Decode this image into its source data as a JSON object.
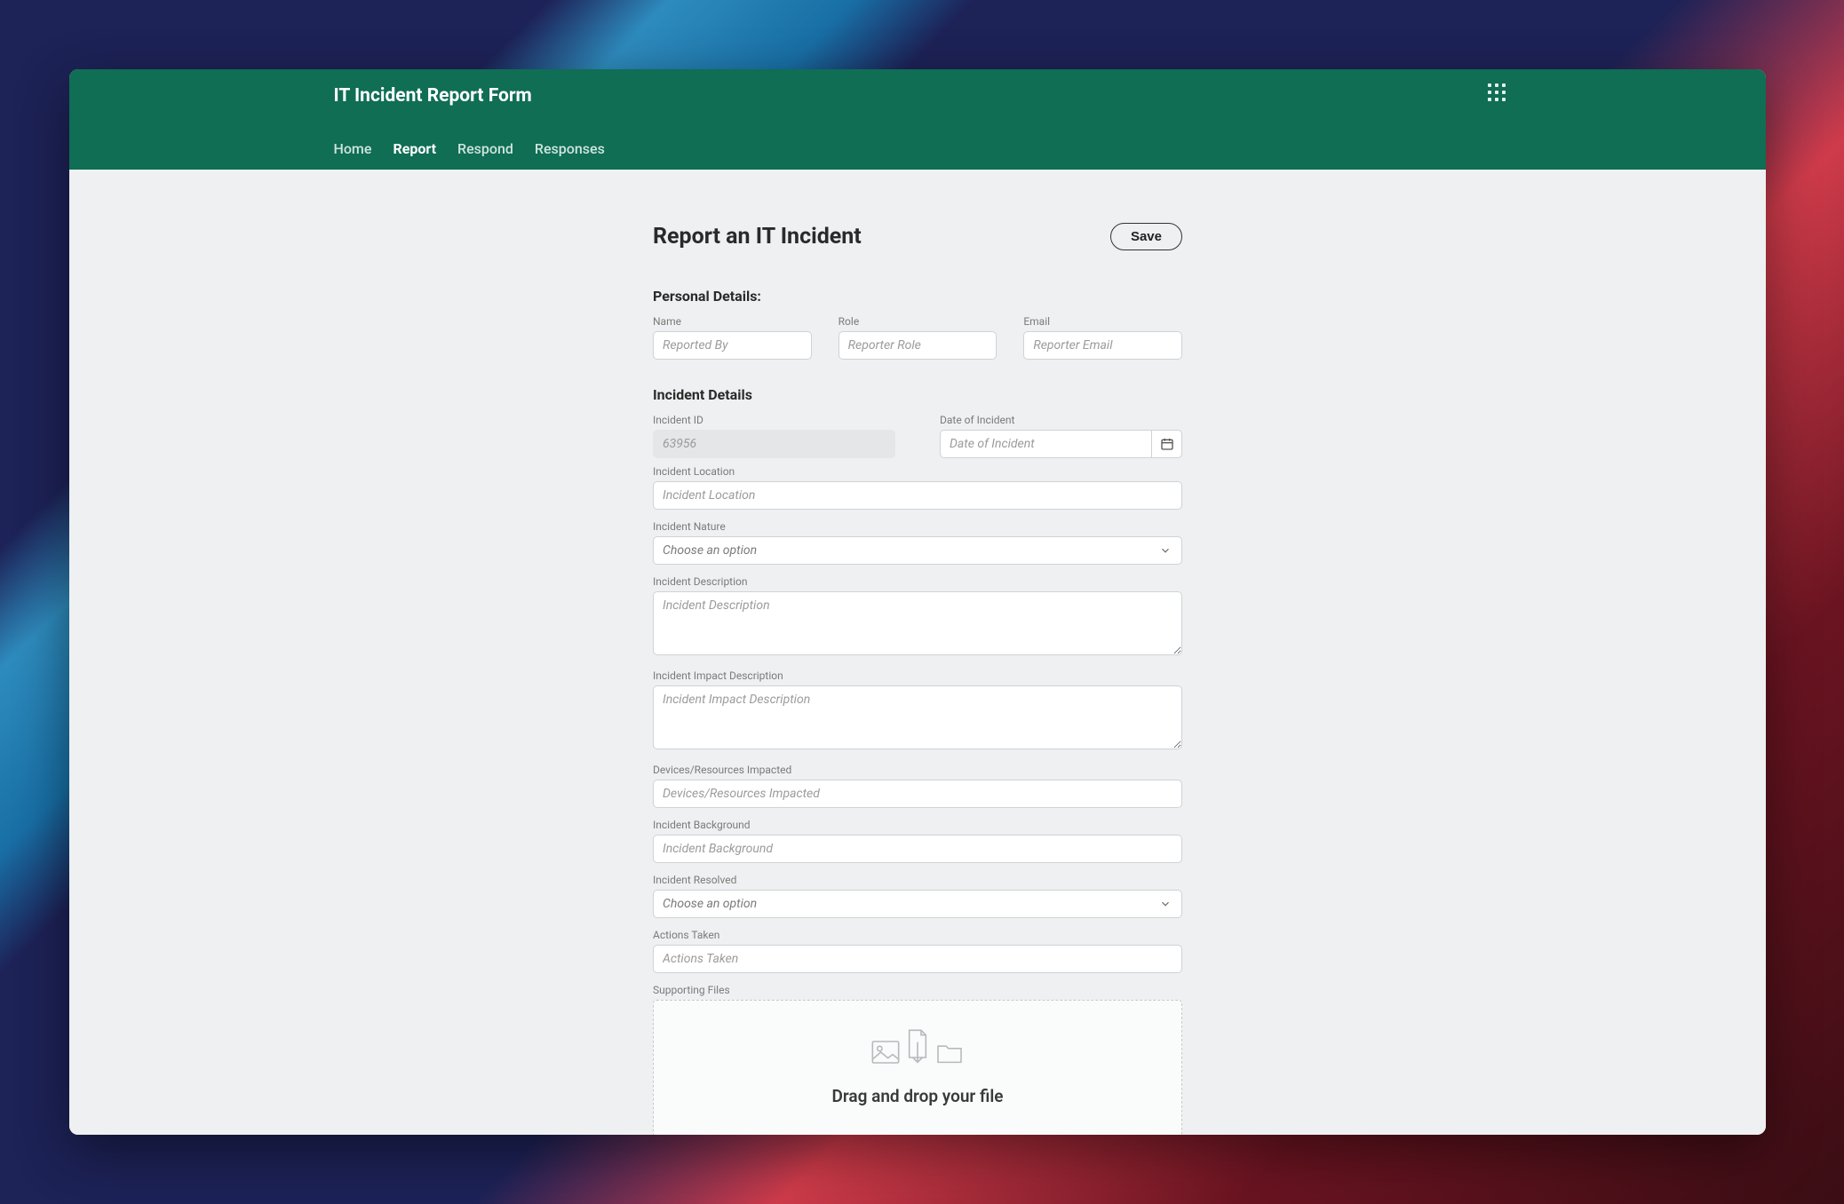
{
  "header": {
    "title": "IT Incident Report Form",
    "nav": {
      "home": "Home",
      "report": "Report",
      "respond": "Respond",
      "responses": "Responses"
    }
  },
  "page": {
    "title": "Report an IT Incident",
    "save_label": "Save"
  },
  "sections": {
    "personal": "Personal Details:",
    "incident": "Incident Details"
  },
  "fields": {
    "name": {
      "label": "Name",
      "placeholder": "Reported By"
    },
    "role": {
      "label": "Role",
      "placeholder": "Reporter Role"
    },
    "email": {
      "label": "Email",
      "placeholder": "Reporter Email"
    },
    "incident_id": {
      "label": "Incident ID",
      "value": "63956"
    },
    "date_of_incident": {
      "label": "Date of Incident",
      "placeholder": "Date of Incident"
    },
    "location": {
      "label": "Incident Location",
      "placeholder": "Incident Location"
    },
    "nature": {
      "label": "Incident Nature",
      "placeholder": "Choose an option"
    },
    "description": {
      "label": "Incident Description",
      "placeholder": "Incident Description"
    },
    "impact": {
      "label": "Incident Impact Description",
      "placeholder": "Incident Impact Description"
    },
    "devices": {
      "label": "Devices/Resources Impacted",
      "placeholder": "Devices/Resources Impacted"
    },
    "background": {
      "label": "Incident Background",
      "placeholder": "Incident Background"
    },
    "resolved": {
      "label": "Incident Resolved",
      "placeholder": "Choose an option"
    },
    "actions": {
      "label": "Actions Taken",
      "placeholder": "Actions Taken"
    },
    "files": {
      "label": "Supporting Files",
      "drop_text": "Drag and drop your file"
    }
  }
}
